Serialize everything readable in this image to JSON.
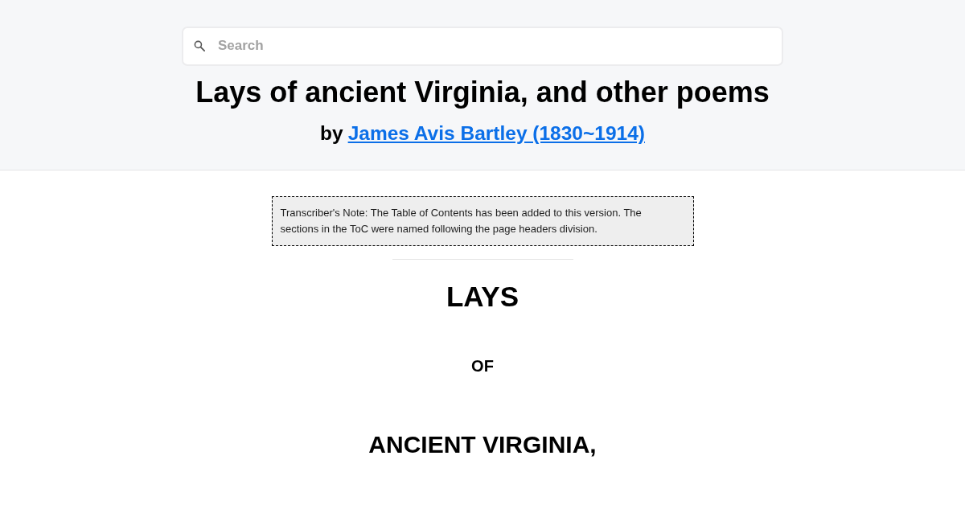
{
  "search": {
    "placeholder": "Search"
  },
  "book": {
    "title": "Lays of ancient Virginia, and other poems",
    "byline_prefix": "by",
    "author_link": "James Avis Bartley (1830~1914)"
  },
  "transcriber_note": "Transcriber's Note: The Table of Contents has been added to this version. The sections in the ToC were named following the page headers division.",
  "title_page": [
    {
      "kind": "large",
      "text": "LAYS"
    },
    {
      "kind": "small",
      "text": "OF"
    },
    {
      "kind": "medium",
      "text": "ANCIENT VIRGINIA,"
    }
  ]
}
